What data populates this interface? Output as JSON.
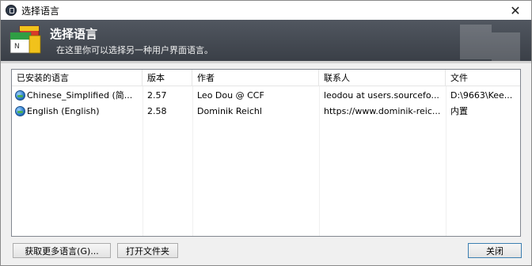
{
  "window": {
    "title": "选择语言",
    "close_glyph": "✕"
  },
  "banner": {
    "title": "选择语言",
    "subtitle": "在这里你可以选择另一种用户界面语言。"
  },
  "list": {
    "columns": [
      "已安装的语言",
      "版本",
      "作者",
      "联系人",
      "文件"
    ],
    "rows": [
      {
        "language": "Chinese_Simplified (简...",
        "version": "2.57",
        "author": "Leo Dou @ CCF",
        "contact": "leodou at users.sourcefo...",
        "file": "D:\\9663\\Kee..."
      },
      {
        "language": "English (English)",
        "version": "2.58",
        "author": "Dominik Reichl",
        "contact": "https://www.dominik-reic...",
        "file": "内置"
      }
    ]
  },
  "buttons": {
    "get_more": "获取更多语言(G)...",
    "open_folder": "打开文件夹",
    "close": "关闭"
  },
  "icons": {
    "app": "keepass-lock-icon",
    "banner": "language-flag-logo-icon",
    "row": "globe-icon"
  },
  "colors": {
    "banner_bg": "#474c55",
    "accent": "#3c7fb1"
  }
}
